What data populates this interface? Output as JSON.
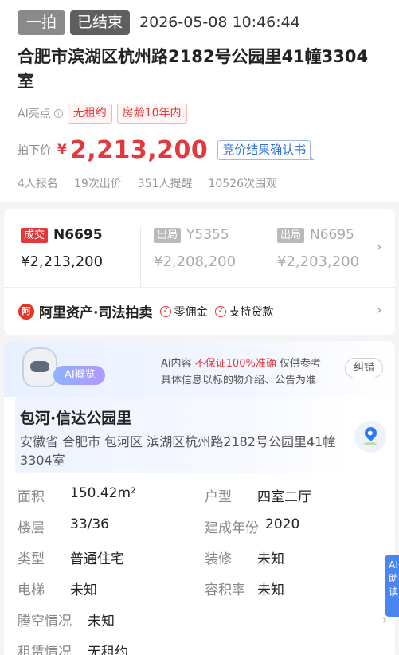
{
  "header": {
    "round_tag": "一拍",
    "status_tag": "已结束",
    "end_time": "2026-05-08 10:46:44",
    "title": "合肥市滨湖区杭州路2182号公园里41幢3304室"
  },
  "highlights": {
    "label": "AI亮点",
    "tags": [
      "无租约",
      "房龄10年内"
    ]
  },
  "price": {
    "label": "拍下价",
    "currency": "¥",
    "value": "2,213,200",
    "confirm_link": "竞价结果确认书"
  },
  "stats": [
    "4人报名",
    "19次出价",
    "351人提醒",
    "10526次围观"
  ],
  "bids": [
    {
      "tag": "成交",
      "code": "N6695",
      "amount": "¥2,213,200",
      "status": "deal"
    },
    {
      "tag": "出局",
      "code": "Y5355",
      "amount": "¥2,208,200",
      "status": "out"
    },
    {
      "tag": "出局",
      "code": "N6695",
      "amount": "¥2,203,200",
      "status": "out"
    }
  ],
  "platform": {
    "name": "阿里资产·司法拍卖",
    "features": [
      "零佣金",
      "支持贷款"
    ]
  },
  "overview": {
    "badge": "AI概览",
    "disclaimer_prefix": "Ai内容",
    "disclaimer_warn": "不保证100%准确",
    "disclaimer_suffix": "仅供参考",
    "disclaimer_line2": "具体信息以标的物介绍、公告为准",
    "fix_button": "纠错",
    "community": "包河·信达公园里",
    "address": "安徽省 合肥市 包河区 滨湖区杭州路2182号公园里41幢3304室",
    "attributes": [
      [
        {
          "k": "面积",
          "v": "150.42m²"
        },
        {
          "k": "户型",
          "v": "四室二厅"
        }
      ],
      [
        {
          "k": "楼层",
          "v": "33/36"
        },
        {
          "k": "建成年份",
          "v": "2020"
        }
      ],
      [
        {
          "k": "类型",
          "v": "普通住宅"
        },
        {
          "k": "装修",
          "v": "未知"
        }
      ],
      [
        {
          "k": "电梯",
          "v": "未知"
        },
        {
          "k": "容积率",
          "v": "未知"
        }
      ]
    ],
    "vacancy": {
      "k": "腾空情况",
      "v": "未知"
    },
    "lease": {
      "k": "租赁情况",
      "v": "无租约"
    }
  },
  "side_button": "AI助读",
  "colors": {
    "accent_red": "#e4393c",
    "link_blue": "#2e6fd6"
  }
}
